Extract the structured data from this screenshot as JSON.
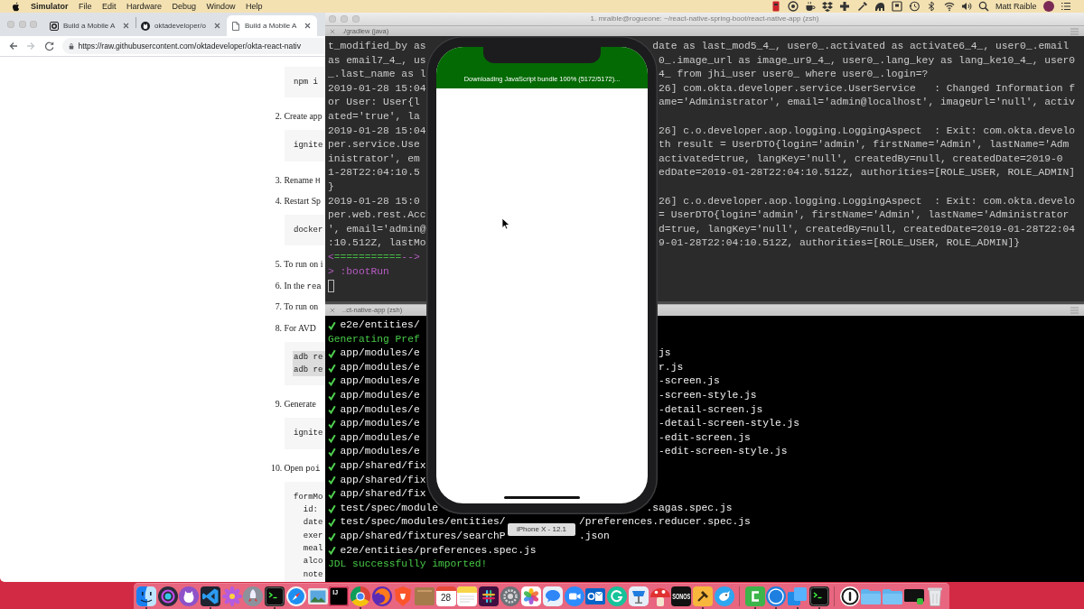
{
  "menu_bar": {
    "app_name": "Simulator",
    "menus": [
      "File",
      "Edit",
      "Hardware",
      "Debug",
      "Window",
      "Help"
    ],
    "user_name": "Matt Raible"
  },
  "browser": {
    "tabs": [
      {
        "title": "Build a Mobile A",
        "selected": false
      },
      {
        "title": "oktadeveloper/o",
        "selected": false
      },
      {
        "title": "Build a Mobile A",
        "selected": true
      }
    ],
    "back": {
      "disabled": false
    },
    "forward": {
      "disabled": true
    },
    "address": "https://raw.githubusercontent.com/oktadeveloper/okta-react-nativ",
    "content": [
      {
        "kind": "code",
        "highlighted": false,
        "lines": [
          "npm i"
        ]
      },
      {
        "kind": "step",
        "text": "2. Create app"
      },
      {
        "kind": "code",
        "highlighted": false,
        "lines": [
          "ignite"
        ]
      },
      {
        "kind": "step",
        "text": "3. Rename",
        "code": "H"
      },
      {
        "kind": "step",
        "text": "4. Restart Sp"
      },
      {
        "kind": "code",
        "highlighted": false,
        "lines": [
          "docker"
        ]
      },
      {
        "kind": "step",
        "text": "5. To run on i"
      },
      {
        "kind": "step",
        "text": "6. In the",
        "code": "rea"
      },
      {
        "kind": "step",
        "text": "7. To run on"
      },
      {
        "kind": "step",
        "text": "8. For AVD"
      },
      {
        "kind": "code",
        "highlighted": true,
        "lines": [
          "adb re",
          "adb re"
        ]
      },
      {
        "kind": "step",
        "text": "9. Generate"
      },
      {
        "kind": "code",
        "highlighted": false,
        "lines": [
          "ignite"
        ]
      },
      {
        "kind": "step",
        "text": "10. Open",
        "code": "poi"
      },
      {
        "kind": "code",
        "highlighted": false,
        "lines": [
          "formMo",
          "  id:",
          "  date",
          "  exer",
          "  meal",
          "  alco",
          "  note"
        ]
      }
    ]
  },
  "terminal": {
    "title": "1. mraible@rogueone: ~/react-native-spring-boot/react-native-app (zsh)",
    "panes": [
      {
        "tab": "./gradlew (java)",
        "lines": [
          {
            "kind": "log",
            "left": "t_modified_by as",
            "right": "date as last_mod5_4_, user0_.activated as activate6_4_, user0_.email"
          },
          {
            "kind": "log",
            "left": "as email7_4_, us",
            "right": "0_.image_url as image_ur9_4_, user0_.lang_key as lang_ke10_4_, user0"
          },
          {
            "kind": "log",
            "left": "_.last_name as l",
            "right": "4_ from jhi_user user0_ where user0_.login=?"
          },
          {
            "kind": "log",
            "left": "2019-01-28 15:04",
            "right": "26] com.okta.developer.service.UserService   : Changed Information f"
          },
          {
            "kind": "log",
            "left": "or User: User{l",
            "right": "ame='Administrator', email='admin@localhost', imageUrl='null', activ"
          },
          {
            "kind": "log",
            "left": "ated='true', la"
          },
          {
            "kind": "log",
            "left": "2019-01-28 15:04",
            "right": "26] c.o.developer.aop.logging.LoggingAspect  : Exit: com.okta.develo"
          },
          {
            "kind": "log",
            "left": "per.service.Use",
            "right": "th result = UserDTO{login='admin', firstName='Admin', lastName='Adm"
          },
          {
            "kind": "log",
            "left": "inistrator', em",
            "right": "activated=true, langKey='null', createdBy=null, createdDate=2019-0"
          },
          {
            "kind": "log",
            "left": "1-28T22:04:10.5",
            "right": "edDate=2019-01-28T22:04:10.512Z, authorities=[ROLE_USER, ROLE_ADMIN]"
          },
          {
            "kind": "log",
            "left": "}"
          },
          {
            "kind": "log",
            "left": "2019-01-28 15:0",
            "right": "26] c.o.developer.aop.logging.LoggingAspect  : Exit: com.okta.develo"
          },
          {
            "kind": "log",
            "left": "per.web.rest.Acc",
            "right": "= UserDTO{login='admin', firstName='Admin', lastName='Administrator"
          },
          {
            "kind": "log",
            "left": "', email='admin@",
            "right": "d=true, langKey='null', createdBy=null, createdDate=2019-01-28T22:04"
          },
          {
            "kind": "log",
            "left": ":10.512Z, lastMo",
            "right": "9-01-28T22:04:10.512Z, authorities=[ROLE_USER, ROLE_ADMIN]}"
          },
          {
            "kind": "progress",
            "parts": [
              "<",
              "===========",
              "-->"
            ]
          },
          {
            "kind": "prompt",
            "left": "> :bootRun"
          },
          {
            "kind": "cursor"
          }
        ]
      },
      {
        "tab": "..ct-native-app (zsh)",
        "lines": [
          {
            "kind": "file",
            "left": "e2e/entities/"
          },
          {
            "kind": "message",
            "left": "Generating Pref"
          },
          {
            "kind": "file",
            "left": "app/modules/e",
            "right": "js"
          },
          {
            "kind": "file",
            "left": "app/modules/e",
            "right": "r.js"
          },
          {
            "kind": "file",
            "left": "app/modules/e",
            "right": "-screen.js"
          },
          {
            "kind": "file",
            "left": "app/modules/e",
            "right": "-screen-style.js"
          },
          {
            "kind": "file",
            "left": "app/modules/e",
            "right": "-detail-screen.js"
          },
          {
            "kind": "file",
            "left": "app/modules/e",
            "right": "-detail-screen-style.js"
          },
          {
            "kind": "file",
            "left": "app/modules/e",
            "right": "-edit-screen.js"
          },
          {
            "kind": "file",
            "left": "app/modules/e",
            "right": "-edit-screen-style.js"
          },
          {
            "kind": "file",
            "left": "app/shared/fix"
          },
          {
            "kind": "file",
            "left": "app/shared/fix"
          },
          {
            "kind": "file",
            "left": "app/shared/fix"
          },
          {
            "kind": "file",
            "left": "test/spec/module",
            "right": ".sagas.spec.js"
          },
          {
            "kind": "file",
            "left": "test/spec/modules/entities/",
            "right": "/preferences.reducer.spec.js"
          },
          {
            "kind": "file",
            "left": "app/shared/fixtures/searchP",
            "right": ".json"
          },
          {
            "kind": "file",
            "left": "e2e/entities/preferences.spec.js"
          },
          {
            "kind": "message",
            "left": "JDL successfully imported!"
          }
        ]
      }
    ]
  },
  "simulator": {
    "banner": "Downloading JavaScript bundle 100% (5172/5172)...",
    "tooltip": "iPhone X - 12.1"
  },
  "dock": {
    "items": [
      {
        "kind": "face",
        "running": true
      },
      {
        "kind": "orb",
        "running": false
      },
      {
        "kind": "cat",
        "running": false
      },
      {
        "kind": "editor",
        "running": true
      },
      {
        "kind": "flower",
        "running": false
      },
      {
        "kind": "rocket",
        "running": false
      },
      {
        "kind": "terminal",
        "running": true
      },
      {
        "kind": "compass",
        "running": false
      },
      {
        "kind": "picture",
        "running": false
      },
      {
        "kind": "ide",
        "label": "IJ",
        "running": false
      },
      {
        "kind": "wheel",
        "running": true
      },
      {
        "kind": "swirl",
        "running": false
      },
      {
        "kind": "shield",
        "running": false
      },
      {
        "kind": "box",
        "running": false
      },
      {
        "kind": "calendar",
        "label": "28",
        "running": false
      },
      {
        "kind": "notepad",
        "running": false
      },
      {
        "kind": "hash",
        "running": false
      },
      {
        "kind": "gear",
        "running": false
      },
      {
        "kind": "petals",
        "running": false
      },
      {
        "kind": "bubble",
        "running": false
      },
      {
        "kind": "camera",
        "running": false
      },
      {
        "kind": "mail",
        "running": false
      },
      {
        "kind": "arc",
        "running": false
      },
      {
        "kind": "podium",
        "running": false
      },
      {
        "kind": "mushroom",
        "running": false
      },
      {
        "kind": "wordmark",
        "label": "SONOS",
        "running": false
      },
      {
        "kind": "hammer",
        "running": true
      },
      {
        "kind": "bird",
        "running": false
      },
      {
        "kind": "separator"
      },
      {
        "kind": "bracket",
        "running": true
      },
      {
        "kind": "ring",
        "running": true
      },
      {
        "kind": "cards",
        "running": true
      },
      {
        "kind": "terminal",
        "running": true
      },
      {
        "kind": "separator"
      },
      {
        "kind": "keyhole",
        "running": false
      },
      {
        "kind": "folder",
        "running": false
      },
      {
        "kind": "folder",
        "running": false
      },
      {
        "kind": "monitor",
        "running": false
      },
      {
        "kind": "trash",
        "running": false
      }
    ]
  }
}
